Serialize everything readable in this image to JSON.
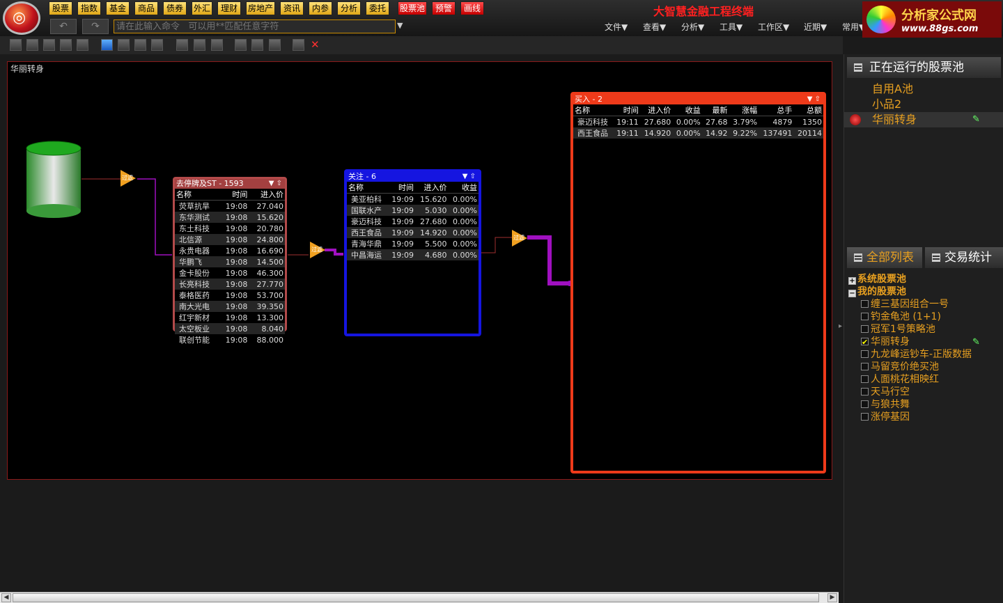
{
  "menu": {
    "buttons": [
      "股票",
      "指数",
      "基金",
      "商品",
      "债券",
      "外汇",
      "理财",
      "房地产",
      "资讯",
      "内参",
      "分析",
      "委托"
    ],
    "red_buttons": [
      "股票池",
      "预警",
      "画线"
    ],
    "app_title": "大智慧金融工程终端",
    "command_placeholder": "请在此输入命令   可以用**匹配任意字符",
    "right_menus": [
      "文件▼",
      "查看▼",
      "分析▼",
      "工具▼",
      "工作区▼",
      "近期▼",
      "常用▼"
    ],
    "brand_line1": "分析家公式网",
    "brand_line2": "www.88gs.com"
  },
  "canvas": {
    "title": "华丽转身",
    "filter_label": "过滤"
  },
  "pool1": {
    "title": "去停牌及ST - 1593",
    "columns": [
      "名称",
      "时间",
      "进入价"
    ],
    "rows": [
      [
        "荧草抗旱",
        "19:08",
        "27.040"
      ],
      [
        "东华测试",
        "19:08",
        "15.620"
      ],
      [
        "东土科技",
        "19:08",
        "20.780"
      ],
      [
        "北信源",
        "19:08",
        "24.800"
      ],
      [
        "永贵电器",
        "19:08",
        "16.690"
      ],
      [
        "华鹏飞",
        "19:08",
        "14.500"
      ],
      [
        "金卡股份",
        "19:08",
        "46.300"
      ],
      [
        "长亮科技",
        "19:08",
        "27.770"
      ],
      [
        "泰格医药",
        "19:08",
        "53.700"
      ],
      [
        "南大光电",
        "19:08",
        "39.350"
      ],
      [
        "红宇新材",
        "19:08",
        "13.300"
      ],
      [
        "太空板业",
        "19:08",
        "8.040"
      ],
      [
        "联创节能",
        "19:08",
        "88.000"
      ]
    ]
  },
  "pool2": {
    "title": "关注 - 6",
    "columns": [
      "名称",
      "时间",
      "进入价",
      "收益"
    ],
    "rows": [
      [
        "美亚柏科",
        "19:09",
        "15.620",
        "0.00%"
      ],
      [
        "国联水产",
        "19:09",
        "5.030",
        "0.00%"
      ],
      [
        "豪迈科技",
        "19:09",
        "27.680",
        "0.00%"
      ],
      [
        "西王食品",
        "19:09",
        "14.920",
        "0.00%"
      ],
      [
        "青海华鼎",
        "19:09",
        "5.500",
        "0.00%"
      ],
      [
        "中昌海运",
        "19:09",
        "4.680",
        "0.00%"
      ]
    ]
  },
  "pool3": {
    "title": "买入 - 2",
    "columns": [
      "名称",
      "时间",
      "进入价",
      "收益",
      "最新",
      "涨幅",
      "总手",
      "总额"
    ],
    "rows": [
      [
        "豪迈科技",
        "19:11",
        "27.680",
        "0.00%",
        "27.68",
        "3.79%",
        "4879",
        "1350"
      ],
      [
        "西王食品",
        "19:11",
        "14.920",
        "0.00%",
        "14.92",
        "9.22%",
        "137491",
        "20114"
      ]
    ]
  },
  "right_panel": {
    "running_title": "正在运行的股票池",
    "running_items": [
      "自用A池",
      "小品2",
      "华丽转身"
    ],
    "tabs": [
      "全部列表",
      "交易统计"
    ],
    "tree_groups": [
      "系统股票池",
      "我的股票池"
    ],
    "tree_items": [
      {
        "label": "缠三基因组合一号",
        "checked": false
      },
      {
        "label": "钓金龟池 (1+1)",
        "checked": false
      },
      {
        "label": "冠军1号策略池",
        "checked": false
      },
      {
        "label": "华丽转身",
        "checked": true
      },
      {
        "label": "九龙峰运钞车-正版数据",
        "checked": false
      },
      {
        "label": "马留竞价绝买池",
        "checked": false
      },
      {
        "label": "人面桃花相映红",
        "checked": false
      },
      {
        "label": "天马行空",
        "checked": false
      },
      {
        "label": "与狼共舞",
        "checked": false
      },
      {
        "label": "涨停基因",
        "checked": false
      }
    ]
  },
  "colors": {
    "pool1_border": "#b34a4a",
    "pool2_border": "#1515e0",
    "pool3_border": "#ee3a1a",
    "pipe": "#a010c0"
  }
}
